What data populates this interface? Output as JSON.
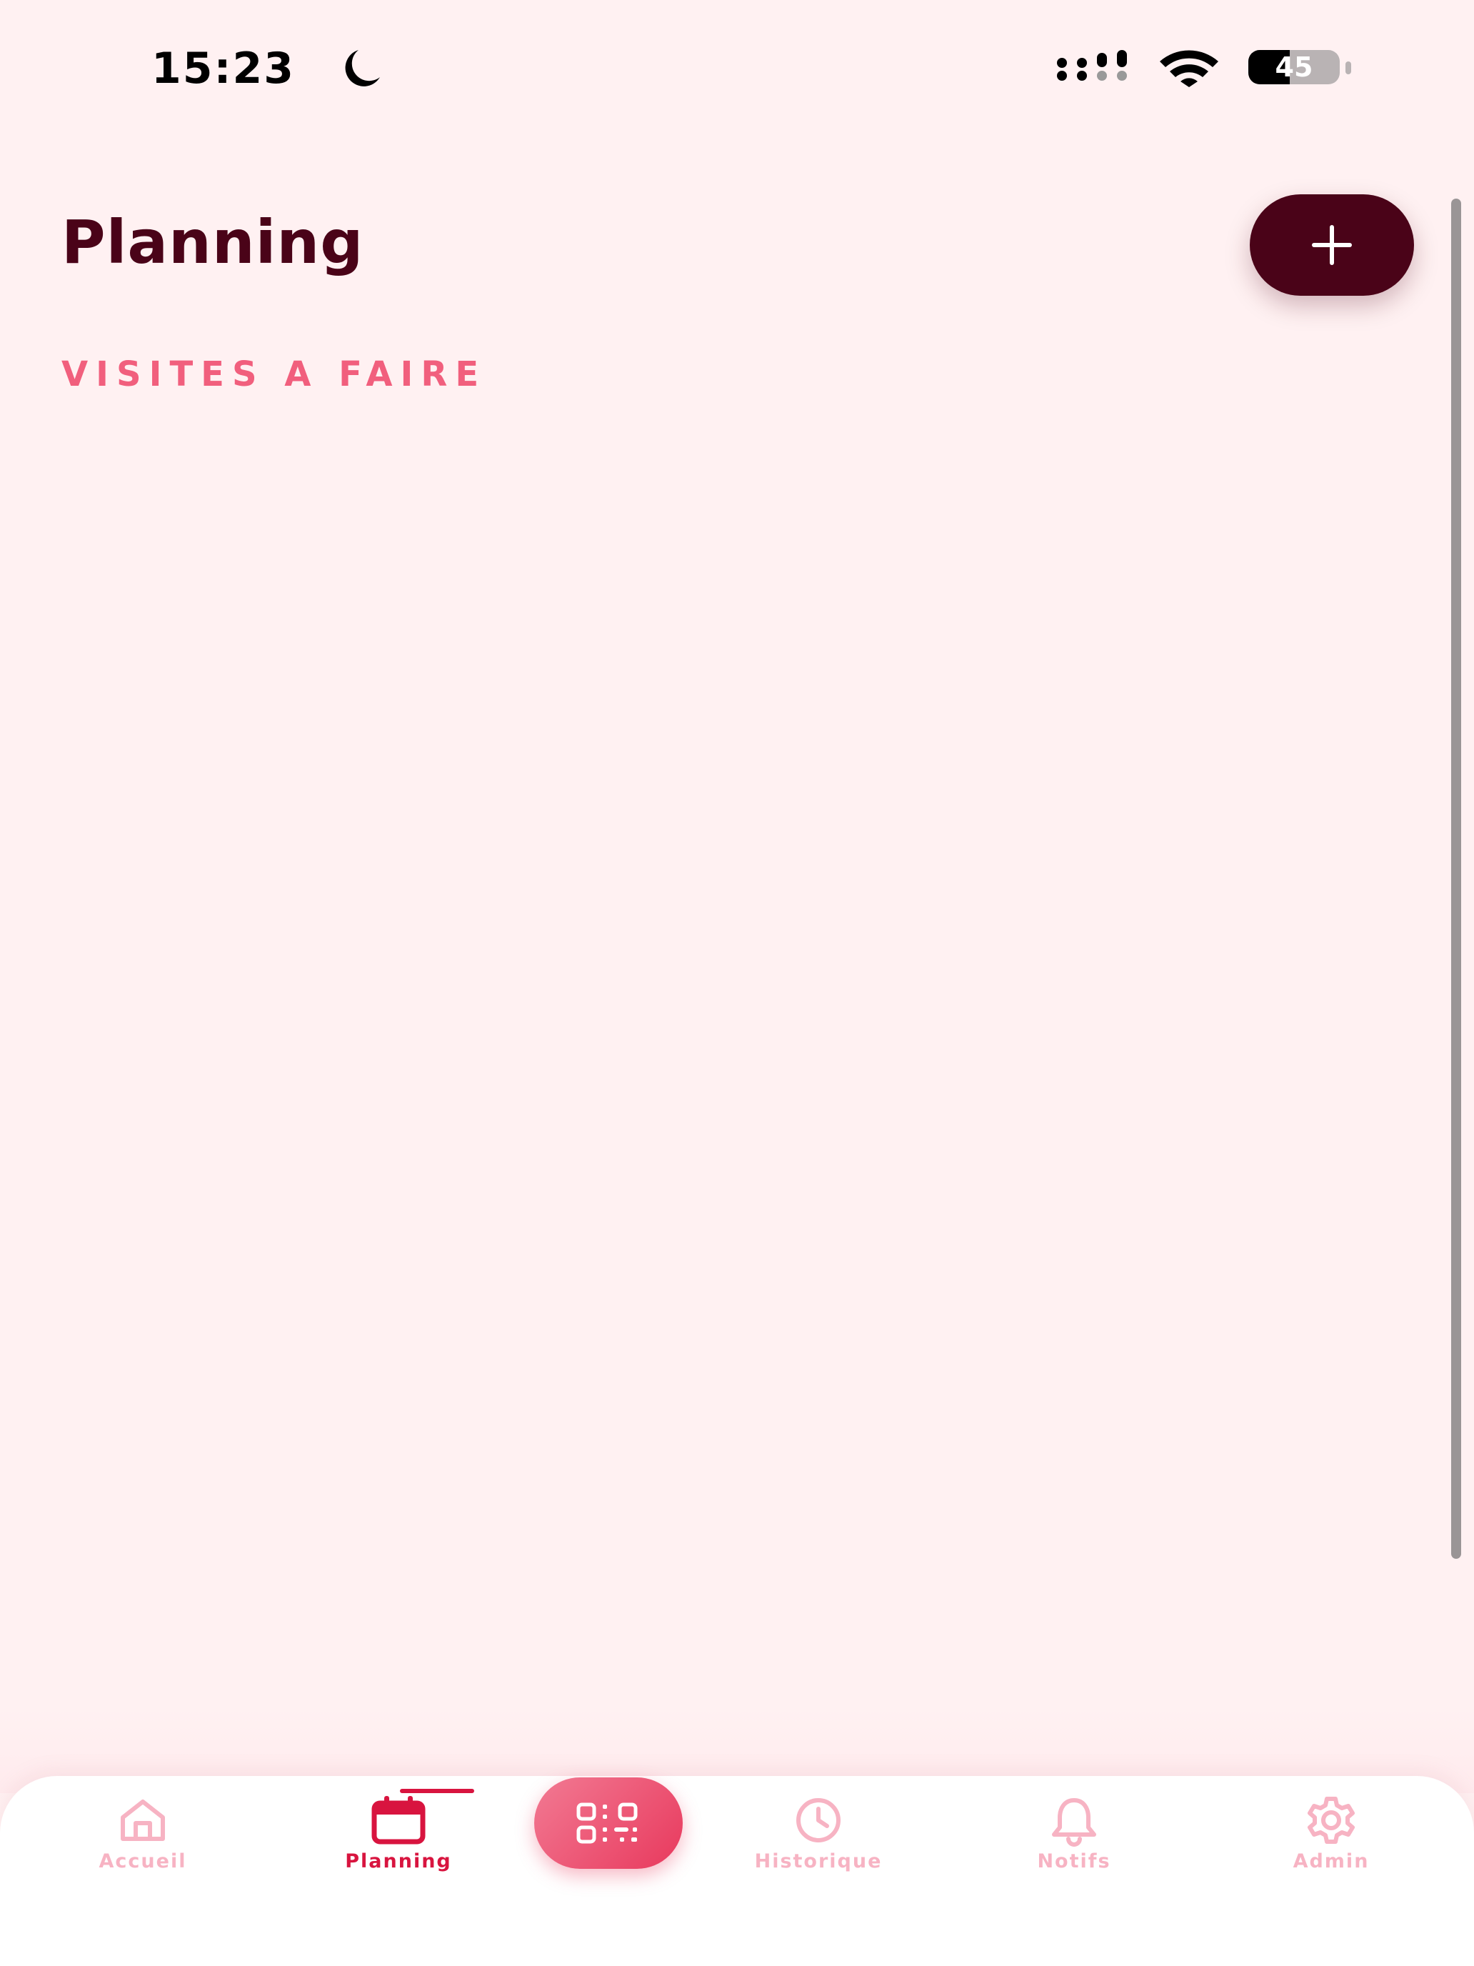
{
  "status_bar": {
    "time": "15:23",
    "battery_level": "45",
    "battery_fraction": 0.45
  },
  "header": {
    "title": "Planning",
    "add_icon": "plus-icon"
  },
  "section": {
    "title": "VISITES A FAIRE"
  },
  "nav": {
    "items": [
      {
        "label": "Accueil",
        "icon": "home-icon",
        "active": false
      },
      {
        "label": "Planning",
        "icon": "calendar-icon",
        "active": true
      },
      {
        "label": "Historique",
        "icon": "clock-icon",
        "active": false
      },
      {
        "label": "Notifs",
        "icon": "bell-icon",
        "active": false
      },
      {
        "label": "Admin",
        "icon": "gear-icon",
        "active": false
      }
    ],
    "scan_icon": "qr-code-icon"
  },
  "colors": {
    "background": "#FFF1F2",
    "title": "#4A0318",
    "accent": "#F15F7D",
    "active": "#D8143F",
    "inactive": "#F7B3C3"
  }
}
